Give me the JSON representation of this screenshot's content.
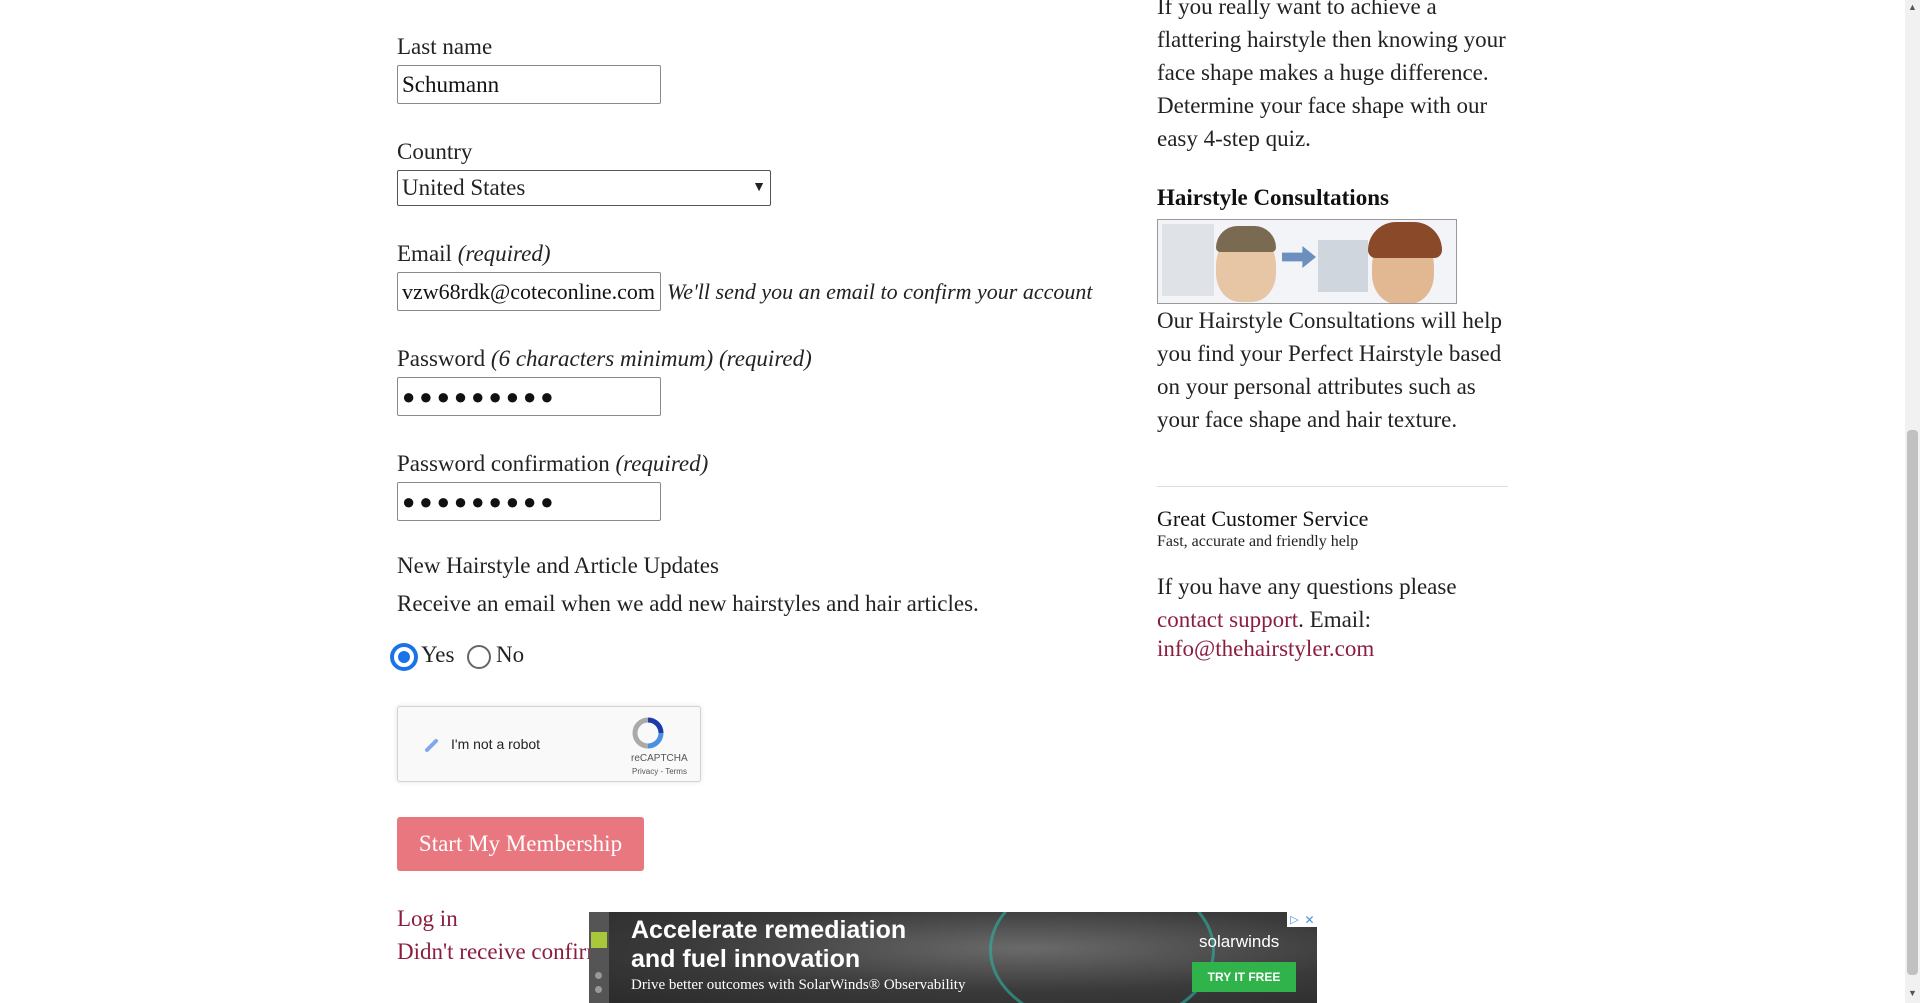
{
  "form": {
    "last_name_label": "Last name",
    "last_name_value": "Schumann",
    "country_label": "Country",
    "country_value": "United States",
    "email_label": "Email",
    "email_required": "(required)",
    "email_value": "vzw68rdk@coteconline.com",
    "email_hint": "We'll send you an email to confirm your account",
    "password_label": "Password",
    "password_min": "(6 characters minimum)",
    "password_required": "(required)",
    "password_value": "●●●●●●●●●",
    "password_confirm_label": "Password confirmation",
    "password_confirm_required": "(required)",
    "password_confirm_value": "●●●●●●●●●",
    "updates_title": "New Hairstyle and Article Updates",
    "updates_desc": "Receive an email when we add new hairstyles and hair articles.",
    "radio_yes": "Yes",
    "radio_no": "No",
    "captcha_label": "I'm not a robot",
    "captcha_brand": "reCAPTCHA",
    "captcha_links": "Privacy - Terms",
    "submit_label": "Start My Membership",
    "login_link": "Log in",
    "resend_link": "Didn't receive confirmation instructions?"
  },
  "sidebar": {
    "quiz_text": "If you really want to achieve a flattering hairstyle then knowing your face shape makes a huge difference. Determine your face shape with our easy 4-step quiz.",
    "consult_title": "Hairstyle Consultations",
    "consult_text": "Our Hairstyle Consultations will help you find your Perfect Hairstyle based on your personal attributes such as your face shape and hair texture.",
    "service_title": "Great Customer Service",
    "service_sub": "Fast, accurate and friendly help",
    "service_text": "If you have any questions please",
    "contact_link": "contact support",
    "email_prefix": ". Email:",
    "email_link": "info@thehairstyler.com"
  },
  "ad": {
    "headline_1": "Accelerate remediation",
    "headline_2": "and fuel innovation",
    "subline": "Drive better outcomes with SolarWinds® Observability",
    "brand": "solarwinds",
    "cta": "TRY IT FREE"
  },
  "colors": {
    "link": "#8b1e3f",
    "button": "#e8777f",
    "ad_cta": "#2fb34a"
  }
}
